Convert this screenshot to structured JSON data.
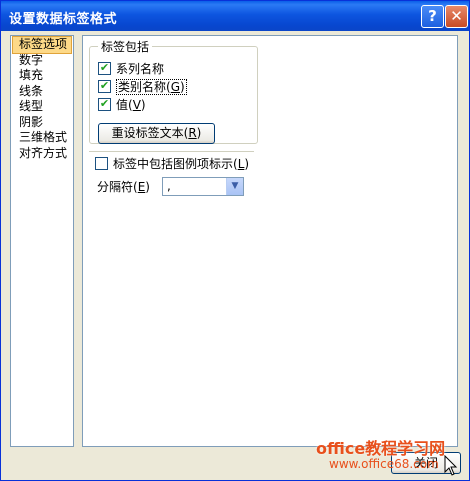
{
  "window": {
    "title": "设置数据标签格式",
    "help_glyph": "?",
    "close_glyph": "✕"
  },
  "sidebar": {
    "items": [
      {
        "label": "标签选项",
        "selected": true
      },
      {
        "label": "数字",
        "selected": false
      },
      {
        "label": "填充",
        "selected": false
      },
      {
        "label": "线条",
        "selected": false
      },
      {
        "label": "线型",
        "selected": false
      },
      {
        "label": "阴影",
        "selected": false
      },
      {
        "label": "三维格式",
        "selected": false
      },
      {
        "label": "对齐方式",
        "selected": false
      }
    ]
  },
  "label_contains": {
    "title": "标签包括",
    "series_name": {
      "label": "系列名称",
      "checked": true
    },
    "category_name": {
      "label": "类别名称",
      "key_open": "(",
      "key": "G",
      "key_close": ")",
      "checked": true
    },
    "value": {
      "label": "值",
      "key_open": "(",
      "key": "V",
      "key_close": ")",
      "checked": true
    },
    "reset_button": {
      "label": "重设标签文本",
      "key_open": "(",
      "key": "R",
      "key_close": ")"
    }
  },
  "include_legend_key": {
    "label": "标签中包括图例项标示",
    "key_open": "(",
    "key": "L",
    "key_close": ")",
    "checked": false
  },
  "separator": {
    "label": "分隔符",
    "key_open": "(",
    "key": "E",
    "key_close": ")",
    "value": ","
  },
  "close_button": {
    "label": "关闭"
  },
  "watermark": {
    "line1": "office教程学习网",
    "line2": "www.office68.com"
  },
  "colors": {
    "titlebar": "#0a5fe8",
    "selected_item": "#fdd988",
    "checkmark": "#21a121",
    "watermark": "#e8501c"
  }
}
